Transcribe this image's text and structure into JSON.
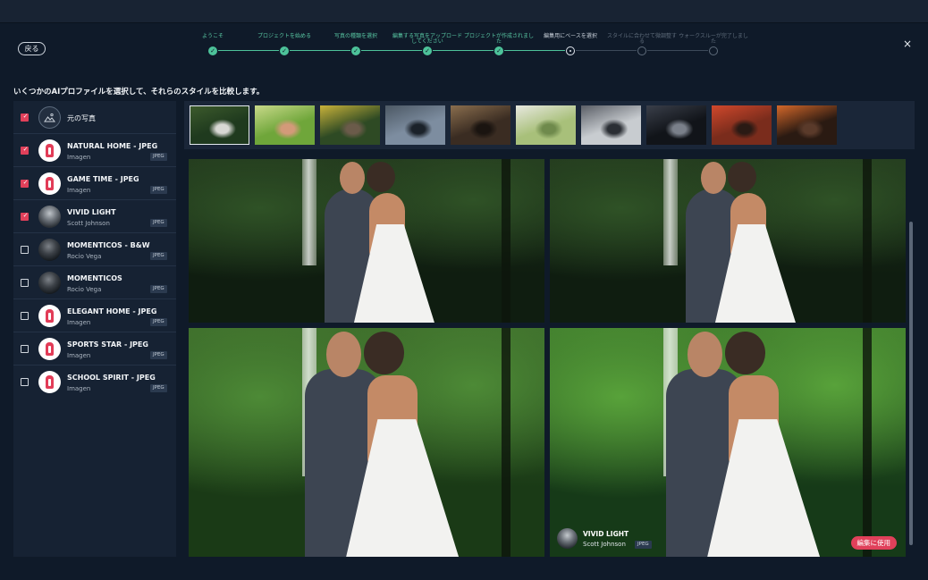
{
  "nav": {
    "back_label": "戻る",
    "close_icon": "×"
  },
  "stepper": {
    "steps": [
      {
        "label": "ようこそ",
        "state": "done"
      },
      {
        "label": "プロジェクトを始める",
        "state": "done"
      },
      {
        "label": "写真の種類を選択",
        "state": "done"
      },
      {
        "label": "編集する写真をアップロードしてください",
        "state": "done"
      },
      {
        "label": "プロジェクトが作成されました",
        "state": "done"
      },
      {
        "label": "編集用にベースを選択",
        "state": "current"
      },
      {
        "label": "スタイルに合わせて微調整する",
        "state": "future"
      },
      {
        "label": "ウォークスルーが完了しました",
        "state": "future"
      }
    ],
    "check_glyph": "✓"
  },
  "instruction": "いくつかのAIプロファイルを選択して、それらのスタイルを比較します。",
  "profiles": [
    {
      "name": "元の写真",
      "creator": "",
      "badge": "",
      "checked": true,
      "avatar": "original"
    },
    {
      "name": "NATURAL HOME - JPEG",
      "creator": "Imagen",
      "badge": "JPEG",
      "checked": true,
      "avatar": "imagen"
    },
    {
      "name": "GAME TIME - JPEG",
      "creator": "Imagen",
      "badge": "JPEG",
      "checked": true,
      "avatar": "imagen"
    },
    {
      "name": "VIVID LIGHT",
      "creator": "Scott Johnson",
      "badge": "JPEG",
      "checked": true,
      "avatar": "gray"
    },
    {
      "name": "MOMENTICOS - B&W",
      "creator": "Rocio Vega",
      "badge": "JPEG",
      "checked": false,
      "avatar": "dark"
    },
    {
      "name": "MOMENTICOS",
      "creator": "Rocio Vega",
      "badge": "JPEG",
      "checked": false,
      "avatar": "dark"
    },
    {
      "name": "ELEGANT HOME - JPEG",
      "creator": "Imagen",
      "badge": "JPEG",
      "checked": false,
      "avatar": "imagen"
    },
    {
      "name": "SPORTS STAR - JPEG",
      "creator": "Imagen",
      "badge": "JPEG",
      "checked": false,
      "avatar": "imagen"
    },
    {
      "name": "SCHOOL SPIRIT - JPEG",
      "creator": "Imagen",
      "badge": "JPEG",
      "checked": false,
      "avatar": "imagen"
    }
  ],
  "thumbnails": [
    {
      "name": "thumb-couple-forest",
      "colors": [
        "#1f3a1e",
        "#3c5a2c",
        "#d8d8d4"
      ],
      "selected": true
    },
    {
      "name": "thumb-woman-leaves",
      "colors": [
        "#6fa63a",
        "#c9d98a",
        "#d39a79"
      ],
      "selected": false
    },
    {
      "name": "thumb-group-outdoor",
      "colors": [
        "#2e4a24",
        "#c9b23a",
        "#6b5b4a"
      ],
      "selected": false
    },
    {
      "name": "thumb-lake-rocks",
      "colors": [
        "#7d8da0",
        "#4c5864",
        "#1b222a"
      ],
      "selected": false
    },
    {
      "name": "thumb-dark-interior",
      "colors": [
        "#3a2c22",
        "#8a6e4e",
        "#1a1410"
      ],
      "selected": false
    },
    {
      "name": "thumb-wedding-table",
      "colors": [
        "#a8c07a",
        "#e8e8e0",
        "#6f8a4c"
      ],
      "selected": false
    },
    {
      "name": "thumb-room-couple",
      "colors": [
        "#c8ccd0",
        "#5a5e66",
        "#2a2e34"
      ],
      "selected": false
    },
    {
      "name": "thumb-motorcycle-night",
      "colors": [
        "#111419",
        "#3a3f4a",
        "#7a808a"
      ],
      "selected": false
    },
    {
      "name": "thumb-bride-red",
      "colors": [
        "#7a2c1c",
        "#d0482c",
        "#2a1a14"
      ],
      "selected": false
    },
    {
      "name": "thumb-band-stage",
      "colors": [
        "#2a1a12",
        "#d4682a",
        "#5a3a2a"
      ],
      "selected": false
    }
  ],
  "previews": [
    {
      "name": "preview-original",
      "tone": "dark"
    },
    {
      "name": "preview-natural-home",
      "tone": "dark"
    },
    {
      "name": "preview-game-time",
      "tone": "bright"
    },
    {
      "name": "preview-vivid-light",
      "tone": "vivid"
    }
  ],
  "caption": {
    "name": "VIVID LIGHT",
    "creator": "Scott Johnson",
    "badge": "JPEG",
    "use_label": "編集に使用"
  },
  "colors": {
    "accent": "#e0405a",
    "step_done": "#4dc39a",
    "background": "#0f1a29",
    "panel": "#162233"
  }
}
